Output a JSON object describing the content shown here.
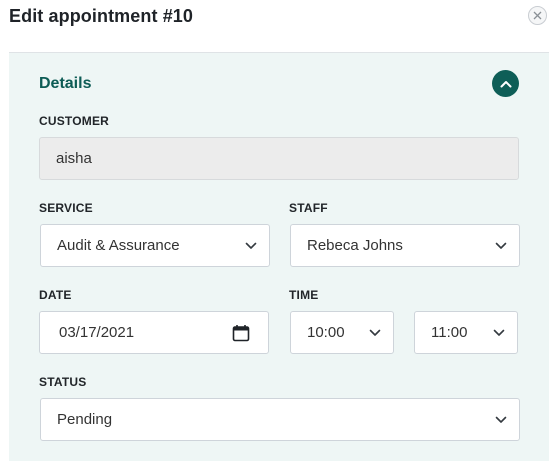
{
  "dialog": {
    "title": "Edit appointment #10",
    "close_label": "×"
  },
  "section": {
    "title": "Details"
  },
  "fields": {
    "customer": {
      "label": "CUSTOMER",
      "value": "aisha"
    },
    "service": {
      "label": "SERVICE",
      "value": "Audit & Assurance"
    },
    "staff": {
      "label": "STAFF",
      "value": "Rebeca Johns"
    },
    "date": {
      "label": "DATE",
      "value": "03/17/2021"
    },
    "time": {
      "label": "TIME",
      "start": "10:00",
      "end": "11:00"
    },
    "status": {
      "label": "STATUS",
      "value": "Pending"
    }
  },
  "icons": {
    "close": "close-icon",
    "collapse": "chevron-up-icon",
    "dropdown": "chevron-down-icon",
    "calendar": "calendar-icon"
  },
  "colors": {
    "accent": "#0e5e57",
    "panel_background": "#eef6f5",
    "section_title": "#0d5c55"
  }
}
